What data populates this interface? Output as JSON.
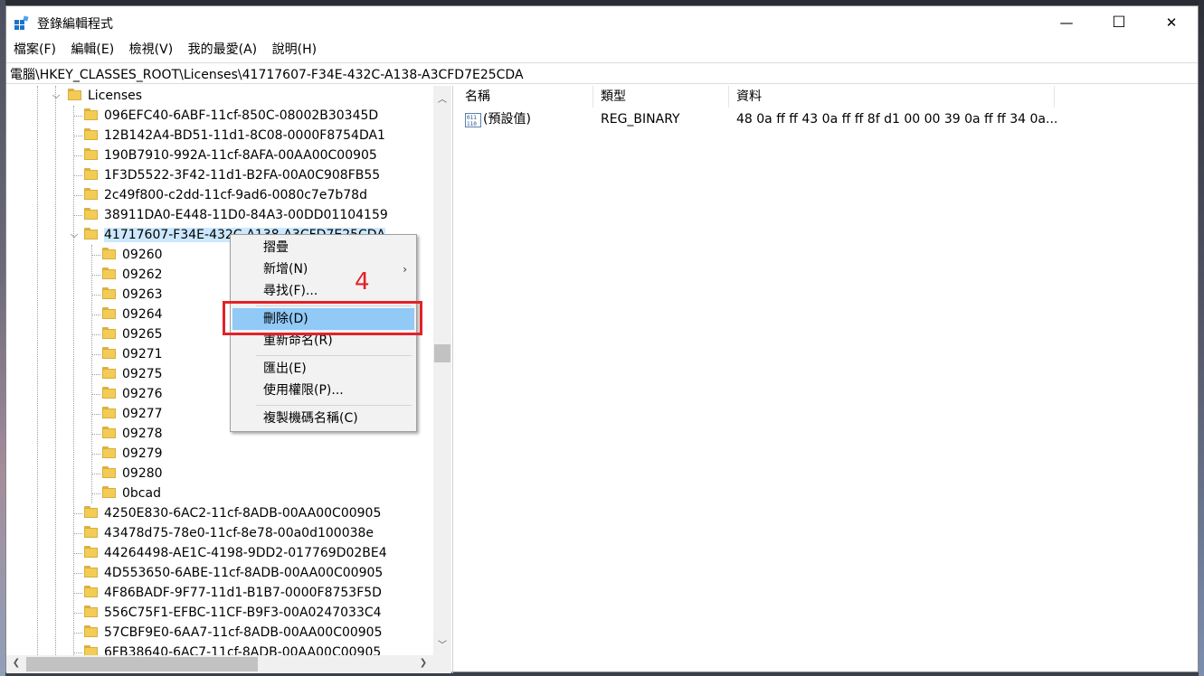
{
  "window": {
    "title": "登錄編輯程式",
    "minimize_glyph": "—",
    "maximize_glyph": "☐",
    "close_glyph": "✕"
  },
  "menu": [
    "檔案(F)",
    "編輯(E)",
    "檢視(V)",
    "我的最愛(A)",
    "說明(H)"
  ],
  "address": "電腦\\HKEY_CLASSES_ROOT\\Licenses\\41717607-F34E-432C-A138-A3CFD7E25CDA",
  "tree": {
    "root": "Licenses",
    "items_before": [
      "096EFC40-6ABF-11cf-850C-08002B30345D",
      "12B142A4-BD51-11d1-8C08-0000F8754DA1",
      "190B7910-992A-11cf-8AFA-00AA00C00905",
      "1F3D5522-3F42-11d1-B2FA-00A0C908FB55",
      "2c49f800-c2dd-11cf-9ad6-0080c7e7b78d",
      "38911DA0-E448-11D0-84A3-00DD01104159"
    ],
    "selected": "41717607-F34E-432C-A138-A3CFD7E25CDA",
    "children": [
      "09260",
      "09262",
      "09263",
      "09264",
      "09265",
      "09271",
      "09275",
      "09276",
      "09277",
      "09278",
      "09279",
      "09280",
      "0bcad"
    ],
    "items_after": [
      "4250E830-6AC2-11cf-8ADB-00AA00C00905",
      "43478d75-78e0-11cf-8e78-00a0d100038e",
      "44264498-AE1C-4198-9DD2-017769D02BE4",
      "4D553650-6ABE-11cf-8ADB-00AA00C00905",
      "4F86BADF-9F77-11d1-B1B7-0000F8753F5D",
      "556C75F1-EFBC-11CF-B9F3-00A0247033C4",
      "57CBF9E0-6AA7-11cf-8ADB-00AA00C00905",
      "6FB38640-6AC7-11cf-8ADB-00AA00C00905"
    ]
  },
  "list": {
    "headers": {
      "name": "名稱",
      "type": "類型",
      "data": "資料"
    },
    "rows": [
      {
        "name": "(預設值)",
        "type": "REG_BINARY",
        "data": "48 0a ff ff 43 0a ff ff 8f d1 00 00 39 0a ff ff 34 0a..."
      }
    ]
  },
  "context_menu": {
    "items": [
      "摺疊",
      "新增(N)",
      "尋找(F)...",
      "刪除(D)",
      "重新命名(R)",
      "匯出(E)",
      "使用權限(P)...",
      "複製機碼名稱(C)"
    ],
    "highlighted": "刪除(D)",
    "submenu_arrow": "›"
  },
  "annotation": {
    "step": "4",
    "color": "#e2222a"
  },
  "colors": {
    "selection": "#cce8ff",
    "menu_highlight": "#91c9f7",
    "folder": "#f2cc55"
  }
}
